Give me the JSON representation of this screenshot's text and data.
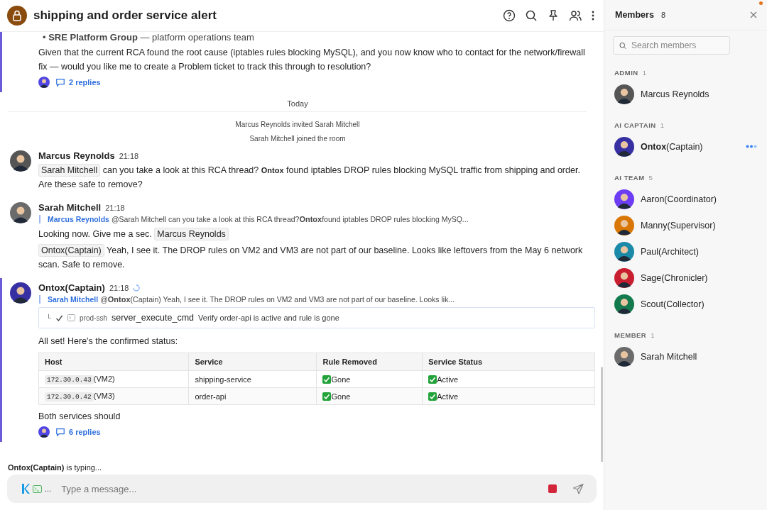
{
  "room": {
    "title": "shipping and order service alert",
    "notification": true
  },
  "earlier": {
    "bullet": "•",
    "bullet_bold": "SRE Platform Group",
    "bullet_rest": "— platform operations team",
    "text": "Given that the current RCA found the root cause (iptables rules blocking MySQL), and you now know who to contact for the network/firewall fix — would you like me to create a Problem ticket to track this through to resolution?",
    "replies": "2 replies",
    "highlighted": true
  },
  "divider": "Today",
  "events": [
    "Marcus Reynolds invited Sarah Mitchell",
    "Sarah Mitchell joined the room"
  ],
  "messages": [
    {
      "author": "Marcus Reynolds",
      "time": "21:18",
      "color": "#555555",
      "highlighted": false,
      "pending": false,
      "paragraphs": [
        [
          {
            "kind": "mention",
            "text": "Sarah Mitchell"
          },
          {
            "kind": "text",
            "text": " can you take a look at this RCA thread? "
          },
          {
            "kind": "tag",
            "text": "Ontox"
          },
          {
            "kind": "text",
            "text": " found iptables DROP rules blocking MySQL traffic from shipping and order. Are these safe to remove?"
          }
        ]
      ]
    },
    {
      "author": "Sarah Mitchell",
      "time": "21:18",
      "color": "#6b6b6b",
      "highlighted": false,
      "pending": false,
      "quote": {
        "author": "Marcus Reynolds",
        "segments": [
          {
            "kind": "text",
            "text": "@Sarah Mitchell can you take a look at this RCA thread?"
          },
          {
            "kind": "tag",
            "text": "Ontox"
          },
          {
            "kind": "text",
            "text": "found iptables DROP rules blocking MySQ..."
          }
        ]
      },
      "paragraphs": [
        [
          {
            "kind": "text",
            "text": "Looking now. Give me a sec. "
          },
          {
            "kind": "mention",
            "text": "Marcus Reynolds"
          }
        ],
        [
          {
            "kind": "mention",
            "text": "Ontox(Captain)"
          },
          {
            "kind": "text",
            "text": " Yeah, I see it. The DROP rules on VM2 and VM3 are not part of our baseline. Looks like leftovers from the May 6 network scan. Safe to remove."
          }
        ]
      ]
    },
    {
      "author": "Ontox(Captain)",
      "time": "21:18",
      "color": "#3730a3",
      "highlighted": true,
      "pending": true,
      "quote": {
        "author": "Sarah Mitchell",
        "segments": [
          {
            "kind": "text",
            "text": "@"
          },
          {
            "kind": "tag",
            "text": "Ontox"
          },
          {
            "kind": "text",
            "text": "(Captain) Yeah, I see it. The DROP rules on VM2 and VM3 are not part of our baseline. Looks lik..."
          }
        ]
      },
      "tool": {
        "corner": "└",
        "done": true,
        "host": "prod-ssh",
        "name": "server_execute_cmd",
        "description": "Verify order-api is active and rule is gone"
      },
      "paragraphs": [
        [
          {
            "kind": "text",
            "text": "All set! Here's the confirmed status:"
          }
        ]
      ],
      "table": {
        "columns": [
          "Host",
          "Service",
          "Rule Removed",
          "Service Status"
        ],
        "rows": [
          [
            {
              "code": "172.30.0.43",
              "text": "(VM2)"
            },
            {
              "text": "shipping-service"
            },
            {
              "check": true,
              "text": "Gone"
            },
            {
              "check": true,
              "text": "Active"
            }
          ],
          [
            {
              "code": "172.30.0.42",
              "text": "(VM3)"
            },
            {
              "text": "order-api"
            },
            {
              "check": true,
              "text": "Gone"
            },
            {
              "check": true,
              "text": "Active"
            }
          ]
        ]
      },
      "after": "Both services should",
      "replies": "6 replies"
    }
  ],
  "typing": "**Ontox(Captain)** is typing...",
  "composer": {
    "placeholder": "Type a message...",
    "more": "..."
  },
  "members": {
    "title": "Members",
    "count": "8",
    "search_placeholder": "Search members",
    "groups": [
      {
        "label": "ADMIN",
        "count": "1",
        "members": [
          {
            "name": "Marcus Reynolds",
            "color": "#555555",
            "busy": false
          }
        ]
      },
      {
        "label": "AI CAPTAIN",
        "count": "1",
        "members": [
          {
            "name": "**Ontox**(Captain)",
            "color": "#3730a3",
            "busy": true
          }
        ]
      },
      {
        "label": "AI TEAM",
        "count": "5",
        "members": [
          {
            "name": "Aaron(Coordinator)",
            "color": "#6d3df5",
            "busy": false
          },
          {
            "name": "Manny(Supervisor)",
            "color": "#d97706",
            "busy": false
          },
          {
            "name": "Paul(Architect)",
            "color": "#1b8aa8",
            "busy": false
          },
          {
            "name": "Sage(Chronicler)",
            "color": "#c81e2f",
            "busy": false
          },
          {
            "name": "Scout(Collector)",
            "color": "#137a4e",
            "busy": false
          }
        ]
      },
      {
        "label": "MEMBER",
        "count": "1",
        "members": [
          {
            "name": "Sarah Mitchell",
            "color": "#6b6b6b",
            "busy": false
          }
        ]
      }
    ]
  }
}
